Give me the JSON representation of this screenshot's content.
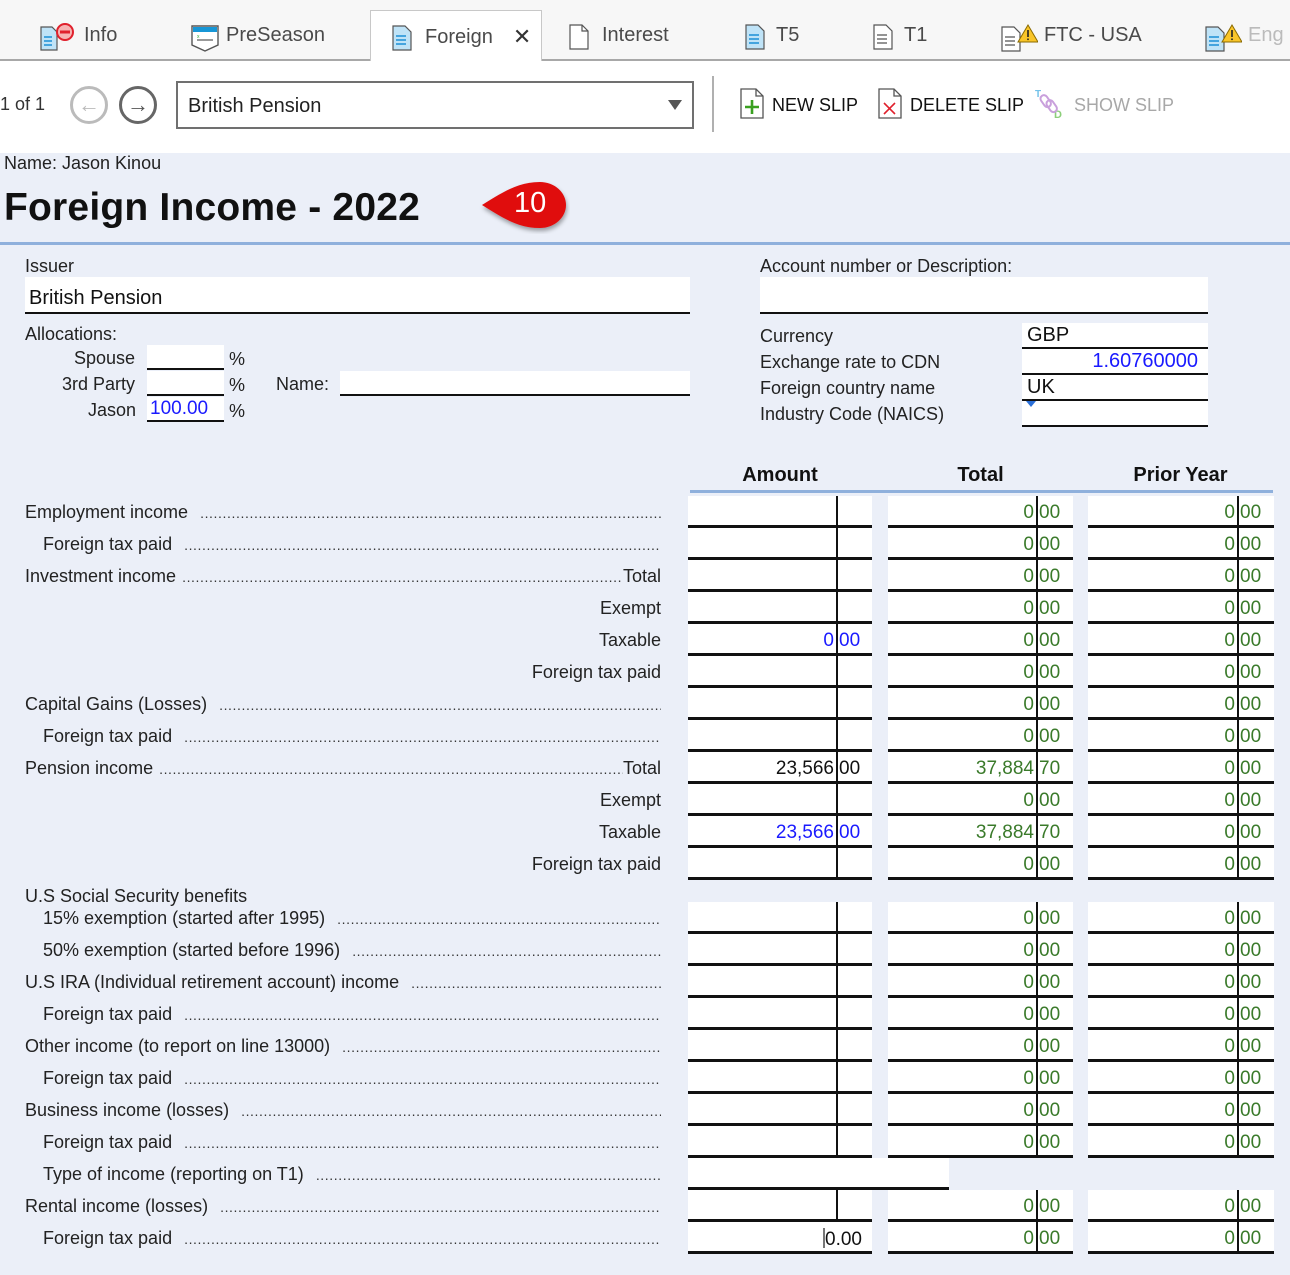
{
  "tabs": [
    {
      "label": "Info",
      "icon": "doc-error-icon",
      "active": false
    },
    {
      "label": "PreSeason",
      "icon": "preseason-icon",
      "active": false
    },
    {
      "label": "Foreign",
      "icon": "doc-blue-icon",
      "active": true
    },
    {
      "label": "Interest",
      "icon": "doc-blank-icon",
      "active": false
    },
    {
      "label": "T5",
      "icon": "doc-blue-icon",
      "active": false
    },
    {
      "label": "T1",
      "icon": "doc-lines-icon",
      "active": false
    },
    {
      "label": "FTC - USA",
      "icon": "doc-warning-icon",
      "active": false
    },
    {
      "label": "Eng",
      "icon": "doc-blue-warning-icon",
      "active": false
    }
  ],
  "toolbar": {
    "pager": "1 of 1",
    "slip_selected": "British Pension",
    "new_slip": "NEW SLIP",
    "delete_slip": "DELETE SLIP",
    "show_slip": "SHOW SLIP"
  },
  "header": {
    "name_line": "Name:  Jason Kinou",
    "title": "Foreign Income - 2022",
    "badge": "10"
  },
  "form": {
    "issuer_label": "Issuer",
    "issuer_value": "British Pension",
    "account_label": "Account number or Description:",
    "account_value": "",
    "allocations_label": "Allocations:",
    "spouse_label": "Spouse",
    "spouse_value": "",
    "third_party_label": "3rd Party",
    "third_party_value": "",
    "third_party_name_label": "Name:",
    "third_party_name_value": "",
    "taxpayer_label": "Jason",
    "taxpayer_value": "100.00",
    "pct": "%",
    "currency_label": "Currency",
    "currency_value": "GBP",
    "exchange_label": "Exchange rate to CDN",
    "exchange_value": "1.60760000",
    "country_label": "Foreign country name",
    "country_value": "UK",
    "naics_label": "Industry Code (NAICS)",
    "naics_value": ""
  },
  "columns": {
    "amount": "Amount",
    "total": "Total",
    "prior": "Prior Year"
  },
  "rows": [
    {
      "label": "Employment income",
      "suffix": "",
      "amount": [
        "",
        ""
      ],
      "total": [
        "0",
        "00"
      ],
      "prior": [
        "0",
        "00"
      ]
    },
    {
      "label": "Foreign tax paid",
      "suffix": "",
      "amount": [
        "",
        ""
      ],
      "total": [
        "0",
        "00"
      ],
      "prior": [
        "0",
        "00"
      ]
    },
    {
      "label": "Investment income",
      "suffix": "Total",
      "amount": [
        "",
        ""
      ],
      "total": [
        "0",
        "00"
      ],
      "prior": [
        "0",
        "00"
      ]
    },
    {
      "label": "Exempt",
      "suffix": "",
      "amount": [
        "",
        ""
      ],
      "total": [
        "0",
        "00"
      ],
      "prior": [
        "0",
        "00"
      ]
    },
    {
      "label": "Taxable",
      "suffix": "",
      "amount": [
        "0",
        "00"
      ],
      "total": [
        "0",
        "00"
      ],
      "prior": [
        "0",
        "00"
      ]
    },
    {
      "label": "Foreign tax paid",
      "suffix": "",
      "amount": [
        "",
        ""
      ],
      "total": [
        "0",
        "00"
      ],
      "prior": [
        "0",
        "00"
      ]
    },
    {
      "label": "Capital Gains (Losses)",
      "suffix": "",
      "amount": [
        "",
        ""
      ],
      "total": [
        "0",
        "00"
      ],
      "prior": [
        "0",
        "00"
      ]
    },
    {
      "label": "Foreign tax paid",
      "suffix": "",
      "amount": [
        "",
        ""
      ],
      "total": [
        "0",
        "00"
      ],
      "prior": [
        "0",
        "00"
      ]
    },
    {
      "label": "Pension income",
      "suffix": "Total",
      "amount": [
        "23,566",
        "00"
      ],
      "total": [
        "37,884",
        "70"
      ],
      "prior": [
        "0",
        "00"
      ]
    },
    {
      "label": "Exempt",
      "suffix": "",
      "amount": [
        "",
        ""
      ],
      "total": [
        "0",
        "00"
      ],
      "prior": [
        "0",
        "00"
      ]
    },
    {
      "label": "Taxable",
      "suffix": "",
      "amount": [
        "23,566",
        "00"
      ],
      "total": [
        "37,884",
        "70"
      ],
      "prior": [
        "0",
        "00"
      ]
    },
    {
      "label": "Foreign tax paid",
      "suffix": "",
      "amount": [
        "",
        ""
      ],
      "total": [
        "0",
        "00"
      ],
      "prior": [
        "0",
        "00"
      ]
    },
    {
      "label": "U.S Social Security benefits",
      "suffix": ""
    },
    {
      "label": "15% exemption (started after 1995)",
      "suffix": "",
      "amount": [
        "",
        ""
      ],
      "total": [
        "0",
        "00"
      ],
      "prior": [
        "0",
        "00"
      ]
    },
    {
      "label": "50% exemption (started before 1996)",
      "suffix": "",
      "amount": [
        "",
        ""
      ],
      "total": [
        "0",
        "00"
      ],
      "prior": [
        "0",
        "00"
      ]
    },
    {
      "label": "U.S IRA (Individual retirement account) income",
      "suffix": "",
      "amount": [
        "",
        ""
      ],
      "total": [
        "0",
        "00"
      ],
      "prior": [
        "0",
        "00"
      ]
    },
    {
      "label": "Foreign tax paid",
      "suffix": "",
      "amount": [
        "",
        ""
      ],
      "total": [
        "0",
        "00"
      ],
      "prior": [
        "0",
        "00"
      ]
    },
    {
      "label": "Other income (to report on line 13000)",
      "suffix": "",
      "amount": [
        "",
        ""
      ],
      "total": [
        "0",
        "00"
      ],
      "prior": [
        "0",
        "00"
      ]
    },
    {
      "label": "Foreign tax paid",
      "suffix": "",
      "amount": [
        "",
        ""
      ],
      "total": [
        "0",
        "00"
      ],
      "prior": [
        "0",
        "00"
      ]
    },
    {
      "label": "Business income (losses)",
      "suffix": "",
      "amount": [
        "",
        ""
      ],
      "total": [
        "0",
        "00"
      ],
      "prior": [
        "0",
        "00"
      ]
    },
    {
      "label": "Foreign tax paid",
      "suffix": "",
      "amount": [
        "",
        ""
      ],
      "total": [
        "0",
        "00"
      ],
      "prior": [
        "0",
        "00"
      ]
    },
    {
      "label": "Type of income (reporting on T1)",
      "suffix": "",
      "text_value": ""
    },
    {
      "label": "Rental income (losses)",
      "suffix": "",
      "amount": [
        "",
        ""
      ],
      "total": [
        "0",
        "00"
      ],
      "prior": [
        "0",
        "00"
      ]
    },
    {
      "label": "Foreign tax paid",
      "suffix": "",
      "amount_editing": "0.00",
      "total": [
        "0",
        "00"
      ],
      "prior": [
        "0",
        "00"
      ]
    }
  ],
  "colors": {
    "accent_rule": "#8fb0dc",
    "computed_value": "#3a7a2a",
    "entered_value": "#1a1aff",
    "badge": "#e01010"
  }
}
